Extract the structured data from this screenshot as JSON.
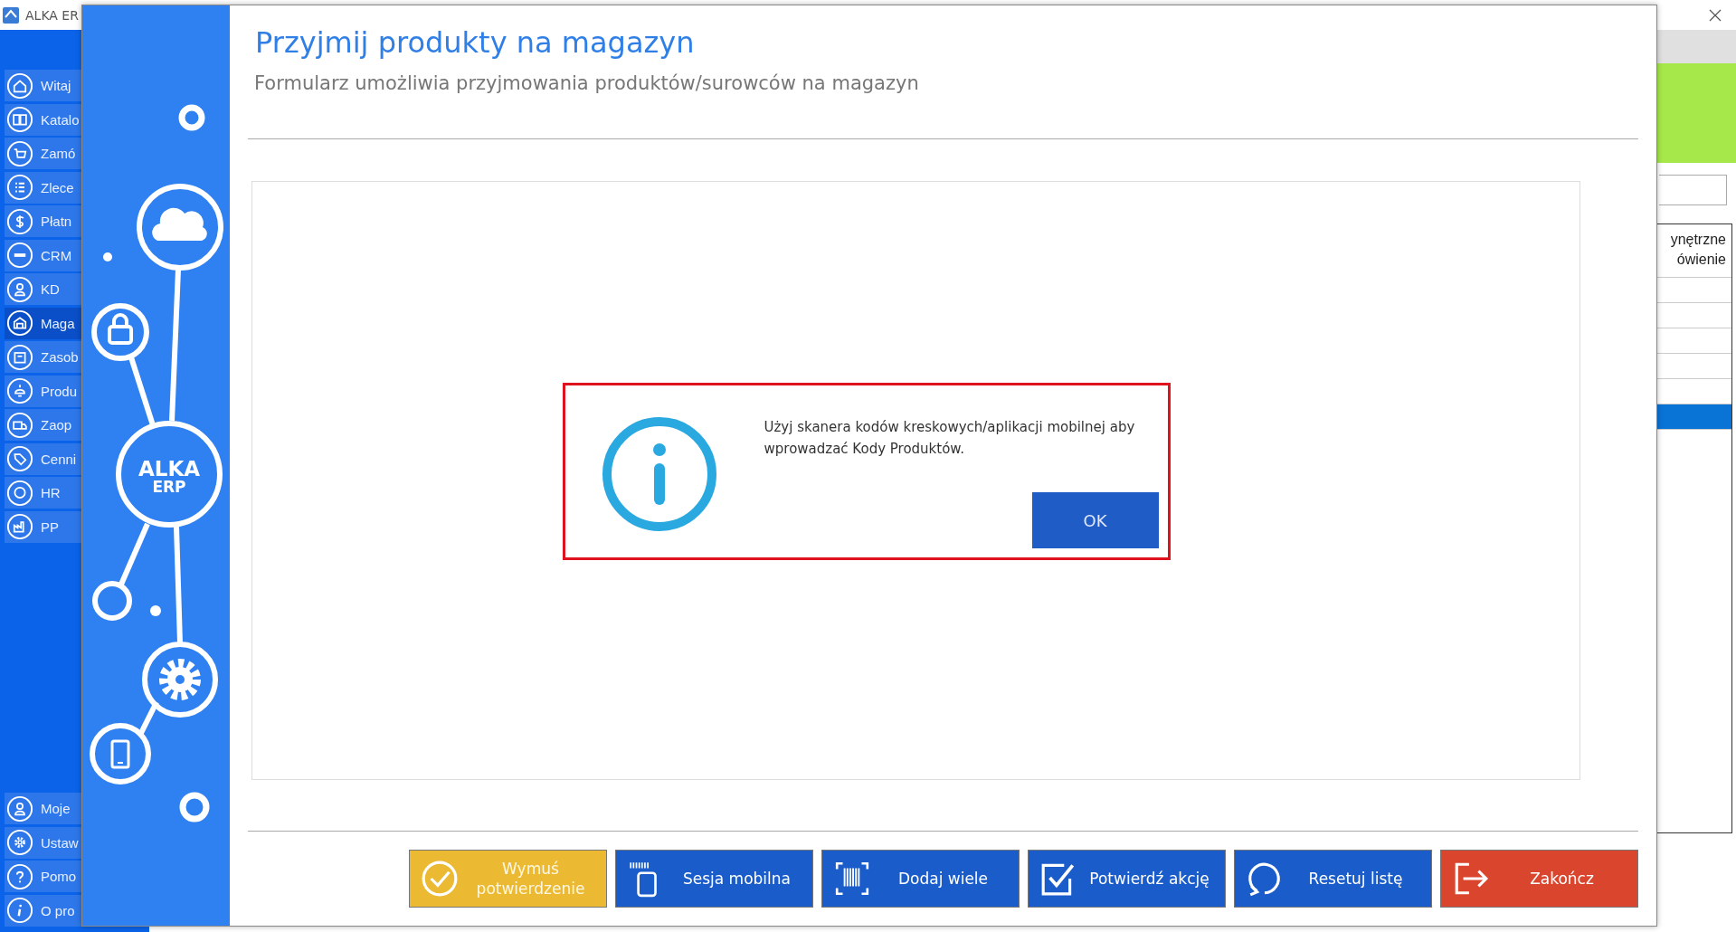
{
  "background_window": {
    "title": "ALKA ER",
    "sidebar": {
      "items": [
        {
          "label": "Witaj",
          "selected": false
        },
        {
          "label": "Katalo",
          "selected": false
        },
        {
          "label": "Zamó",
          "selected": false
        },
        {
          "label": "Zlece",
          "selected": false
        },
        {
          "label": "Płatn",
          "selected": false
        },
        {
          "label": "CRM",
          "selected": false
        },
        {
          "label": "KD",
          "selected": false
        },
        {
          "label": "Maga",
          "selected": true
        },
        {
          "label": "Zasob",
          "selected": false
        },
        {
          "label": "Produ",
          "selected": false
        },
        {
          "label": "Zaop",
          "selected": false
        },
        {
          "label": "Cenni",
          "selected": false
        },
        {
          "label": "HR",
          "selected": false
        },
        {
          "label": "PP",
          "selected": false
        }
      ],
      "bottom_items": [
        {
          "label": "Moje",
          "selected": false
        },
        {
          "label": "Ustaw",
          "selected": false
        },
        {
          "label": "Pomo",
          "selected": false
        },
        {
          "label": "O pro",
          "selected": false
        }
      ]
    },
    "table": {
      "column_1": [
        "ynętrzne",
        "ówienie"
      ],
      "rows": [
        {
          "selected": false
        },
        {
          "selected": false
        },
        {
          "selected": false
        },
        {
          "selected": false
        },
        {
          "selected": false
        },
        {
          "selected": true
        }
      ]
    }
  },
  "form_window": {
    "logo": [
      "ALKA",
      "ERP"
    ],
    "title": "Przyjmij produkty na magazyn",
    "subtitle": "Formularz umożliwia przyjmowania produktów/surowców na magazyn",
    "message_box": {
      "text": "Użyj skanera kodów kreskowych/aplikacji mobilnej aby wprowadzać Kody Produktów.",
      "button": "OK"
    },
    "buttons": [
      {
        "label": "Wymuś potwierdzenie",
        "kind": "warning"
      },
      {
        "label": "Sesja mobilna",
        "kind": "primary"
      },
      {
        "label": "Dodaj wiele",
        "kind": "primary"
      },
      {
        "label": "Potwierdź akcję",
        "kind": "primary"
      },
      {
        "label": "Resetuj listę",
        "kind": "primary"
      },
      {
        "label": "Zakończ",
        "kind": "danger"
      }
    ]
  }
}
